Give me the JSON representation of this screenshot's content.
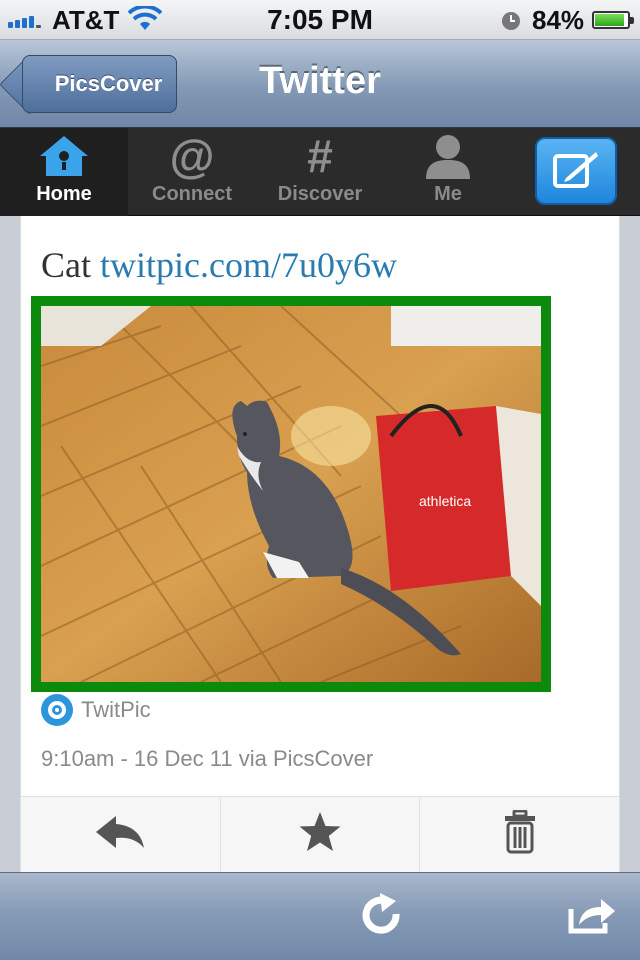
{
  "status_bar": {
    "carrier": "AT&T",
    "time": "7:05 PM",
    "battery_percent": "84%",
    "battery_level": 0.84,
    "icons": [
      "signal-icon",
      "wifi-icon",
      "alarm-icon",
      "battery-icon"
    ]
  },
  "nav_bar": {
    "back_label": "PicsCover",
    "title": "Twitter"
  },
  "tabs": [
    {
      "label": "Home",
      "icon": "home-icon",
      "active": true
    },
    {
      "label": "Connect",
      "icon": "at-icon",
      "active": false
    },
    {
      "label": "Discover",
      "icon": "hash-icon",
      "active": false
    },
    {
      "label": "Me",
      "icon": "person-icon",
      "active": false
    }
  ],
  "compose_icon": "compose-icon",
  "tweet": {
    "text": "Cat",
    "link": "twitpic.com/7u0y6w",
    "photo_text": "athletica",
    "source": "TwitPic",
    "timestamp": "9:10am - 16 Dec 11",
    "via": "via PicsCover"
  },
  "actions": [
    "reply-icon",
    "favorite-icon",
    "delete-icon"
  ],
  "toolbar": [
    "refresh-icon",
    "share-icon"
  ],
  "colors": {
    "accent": "#2a7bb0",
    "photo_border": "#0b8a0b",
    "compose": "#2f95e4"
  }
}
